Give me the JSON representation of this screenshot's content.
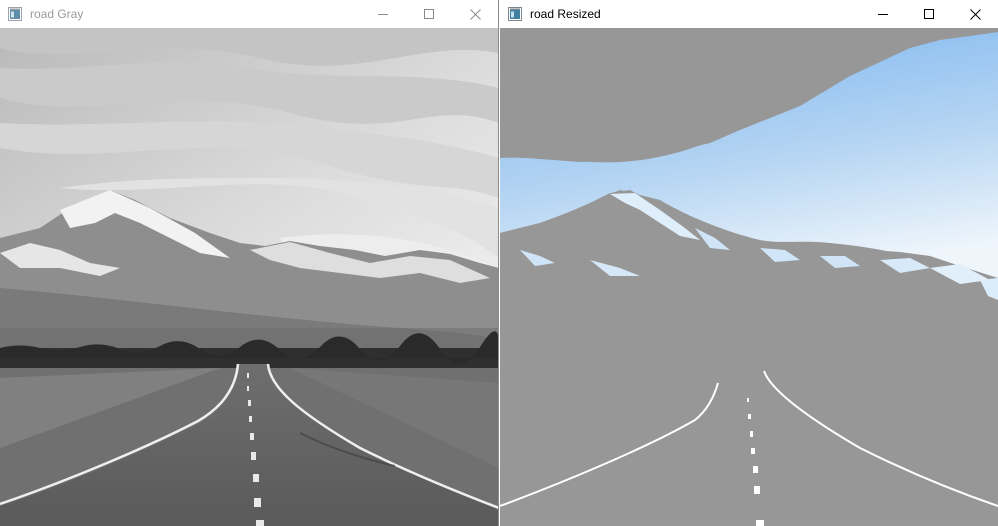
{
  "windows": [
    {
      "title": "road Gray",
      "active": false
    },
    {
      "title": "road Resized",
      "active": true
    }
  ],
  "icons": {
    "app": "opencv-window-icon",
    "minimize": "minimize-icon",
    "maximize": "maximize-icon",
    "close": "close-icon"
  },
  "colors": {
    "resized_background": "#979797",
    "sky_top": "#7cb7f0",
    "sky_bottom": "#eef5fb",
    "gray_sky_top": "#bdbdbd",
    "gray_sky_bottom": "#f1f1f1"
  }
}
